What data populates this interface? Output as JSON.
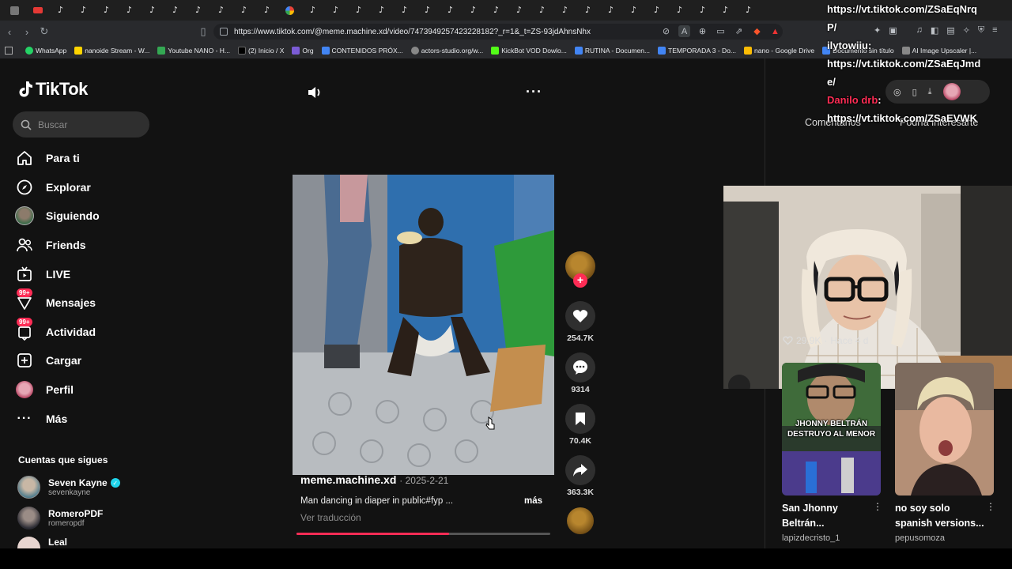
{
  "browser": {
    "url": "https://www.tiktok.com/@meme.machine.xd/video/7473949257423228182?_r=1&_t=ZS-93jdAhnsNhx",
    "bookmarks": [
      {
        "label": "WhatsApp",
        "color": "#25d366"
      },
      {
        "label": "nanoide Stream - W...",
        "color": "#ffd400"
      },
      {
        "label": "Youtube NANO - H...",
        "color": "#34a853"
      },
      {
        "label": "(2) Inicio / X",
        "color": "#000000"
      },
      {
        "label": "Org",
        "color": "#7b5cd6"
      },
      {
        "label": "CONTENIDOS PRÓX...",
        "color": "#4285f4"
      },
      {
        "label": "actors-studio.org/w...",
        "color": "#888888"
      },
      {
        "label": "KickBot VOD Dowlo...",
        "color": "#53fc18"
      },
      {
        "label": "RUTINA - Documen...",
        "color": "#4285f4"
      },
      {
        "label": "TEMPORADA 3 - Do...",
        "color": "#4285f4"
      },
      {
        "label": "nano - Google Drive",
        "color": "#fbbc05"
      },
      {
        "label": "Documento sin título",
        "color": "#4285f4"
      },
      {
        "label": "AI Image Upscaler |...",
        "color": "#888888"
      }
    ]
  },
  "overlay": {
    "line1": "https://vt.tiktok.com/ZSaEqNrq",
    "line2": "P/",
    "user1": "ilytowiiu:",
    "line3": "https://vt.tiktok.com/ZSaEqJmd",
    "line4": "e/",
    "user2": "Danilo drb",
    "line5": "https://vt.tiktok.com/ZSaEVWK"
  },
  "sidebar": {
    "search_placeholder": "Buscar",
    "nav": [
      {
        "label": "Para ti",
        "icon": "home-icon"
      },
      {
        "label": "Explorar",
        "icon": "compass-icon"
      },
      {
        "label": "Siguiendo",
        "icon": "following-avatar-icon"
      },
      {
        "label": "Friends",
        "icon": "friends-icon"
      },
      {
        "label": "LIVE",
        "icon": "live-icon"
      },
      {
        "label": "Mensajes",
        "icon": "messages-icon",
        "badge": "99+"
      },
      {
        "label": "Actividad",
        "icon": "activity-icon",
        "badge": "99+"
      },
      {
        "label": "Cargar",
        "icon": "upload-icon"
      },
      {
        "label": "Perfil",
        "icon": "profile-avatar-icon"
      },
      {
        "label": "Más",
        "icon": "more-icon"
      }
    ],
    "following_title": "Cuentas que sigues",
    "accounts": [
      {
        "name": "Seven Kayne",
        "handle": "sevenkayne",
        "verified": true
      },
      {
        "name": "RomeroPDF",
        "handle": "romeropdf",
        "verified": false
      },
      {
        "name": "Leal",
        "handle": "",
        "verified": false
      }
    ]
  },
  "video": {
    "username": "meme.machine.xd",
    "date": "2025-2-21",
    "description": "Man dancing in diaper in public#fyp ...",
    "more": "más",
    "translate": "Ver traducción",
    "progress": 0.6
  },
  "actions": {
    "likes": "254.7K",
    "comments": "9314",
    "saves": "70.4K",
    "shares": "363.3K"
  },
  "right": {
    "tab_comments": "Comentarios",
    "tab_interest": "Podría interesarte",
    "likes": "29.9K",
    "time": "Hace 4 d",
    "cards": [
      {
        "title": "San Jhonny Beltrán...",
        "user": "lapizdecristo_1",
        "overlay": "JHONNY BELTRÁN DESTRUYO AL MENOR"
      },
      {
        "title": "no soy solo spanish versions...",
        "user": "pepusomoza",
        "overlay": ""
      }
    ]
  },
  "theme": {
    "accent": "#fe2c55",
    "verified": "#20d5ec"
  }
}
